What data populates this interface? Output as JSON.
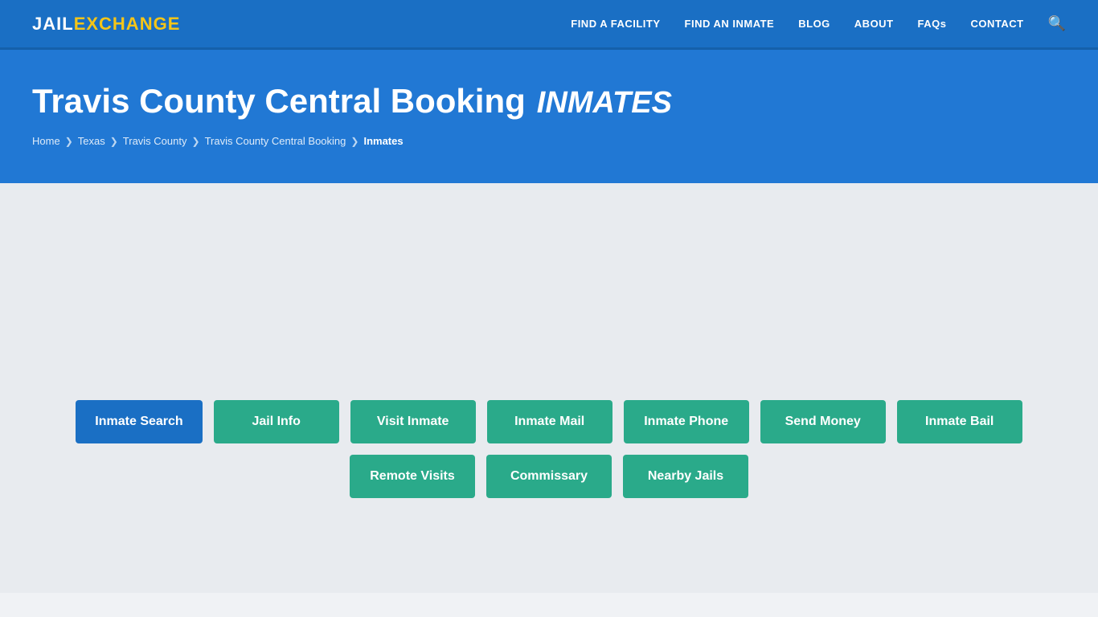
{
  "header": {
    "logo_jail": "JAIL",
    "logo_exchange": "EXCHANGE",
    "nav": [
      {
        "label": "FIND A FACILITY",
        "id": "find-facility"
      },
      {
        "label": "FIND AN INMATE",
        "id": "find-inmate"
      },
      {
        "label": "BLOG",
        "id": "blog"
      },
      {
        "label": "ABOUT",
        "id": "about"
      },
      {
        "label": "FAQs",
        "id": "faqs"
      },
      {
        "label": "CONTACT",
        "id": "contact"
      }
    ]
  },
  "hero": {
    "title_main": "Travis County Central Booking",
    "title_sub": "INMATES",
    "breadcrumb": [
      {
        "label": "Home",
        "active": false
      },
      {
        "label": "Texas",
        "active": false
      },
      {
        "label": "Travis County",
        "active": false
      },
      {
        "label": "Travis County Central Booking",
        "active": false
      },
      {
        "label": "Inmates",
        "active": true
      }
    ]
  },
  "tabs": {
    "row1": [
      {
        "label": "Inmate Search",
        "active": true,
        "id": "inmate-search"
      },
      {
        "label": "Jail Info",
        "active": false,
        "id": "jail-info"
      },
      {
        "label": "Visit Inmate",
        "active": false,
        "id": "visit-inmate"
      },
      {
        "label": "Inmate Mail",
        "active": false,
        "id": "inmate-mail"
      },
      {
        "label": "Inmate Phone",
        "active": false,
        "id": "inmate-phone"
      },
      {
        "label": "Send Money",
        "active": false,
        "id": "send-money"
      },
      {
        "label": "Inmate Bail",
        "active": false,
        "id": "inmate-bail"
      }
    ],
    "row2": [
      {
        "label": "Remote Visits",
        "active": false,
        "id": "remote-visits"
      },
      {
        "label": "Commissary",
        "active": false,
        "id": "commissary"
      },
      {
        "label": "Nearby Jails",
        "active": false,
        "id": "nearby-jails"
      }
    ]
  }
}
